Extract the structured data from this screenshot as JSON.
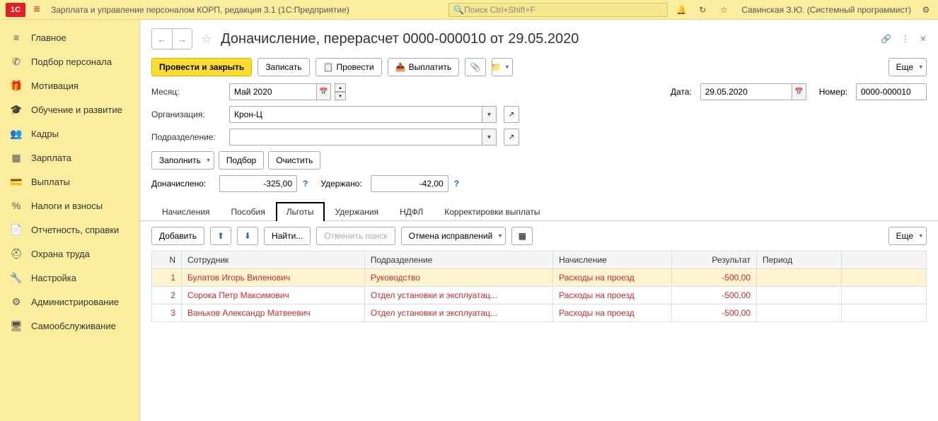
{
  "topbar": {
    "app_title": "Зарплата и управление персоналом КОРП, редакция 3.1  (1С:Предприятие)",
    "search_placeholder": "Поиск Ctrl+Shift+F",
    "user": "Савинская З.Ю. (Системный программист)"
  },
  "sidebar": {
    "items": [
      "Главное",
      "Подбор персонала",
      "Мотивация",
      "Обучение и развитие",
      "Кадры",
      "Зарплата",
      "Выплаты",
      "Налоги и взносы",
      "Отчетность, справки",
      "Охрана труда",
      "Настройка",
      "Администрирование",
      "Самообслуживание"
    ]
  },
  "doc": {
    "title": "Доначисление, перерасчет 0000-000010 от 29.05.2020"
  },
  "toolbar": {
    "post_close": "Провести и закрыть",
    "write": "Записать",
    "post": "Провести",
    "pay": "Выплатить",
    "more": "Еще"
  },
  "form": {
    "month_label": "Месяц:",
    "month_value": "Май 2020",
    "date_label": "Дата:",
    "date_value": "29.05.2020",
    "number_label": "Номер:",
    "number_value": "0000-000010",
    "org_label": "Организация:",
    "org_value": "Крон-Ц",
    "dept_label": "Подразделение:",
    "dept_value": "",
    "fill": "Заполнить",
    "select": "Подбор",
    "clear": "Очистить",
    "accrued_label": "Доначислено:",
    "accrued_value": "-325,00",
    "withheld_label": "Удержано:",
    "withheld_value": "-42,00"
  },
  "tabs": {
    "t0": "Начисления",
    "t1": "Пособия",
    "t2": "Льготы",
    "t3": "Удержания",
    "t4": "НДФЛ",
    "t5": "Корректировки выплаты"
  },
  "table_toolbar": {
    "add": "Добавить",
    "find": "Найти...",
    "cancel_search": "Отменить поиск",
    "cancel_corr": "Отмена исправлений",
    "more": "Еще"
  },
  "table": {
    "headers": {
      "n": "N",
      "employee": "Сотрудник",
      "dept": "Подразделение",
      "accrual": "Начисление",
      "result": "Результат",
      "period": "Период"
    },
    "rows": [
      {
        "n": "1",
        "employee": "Булатов Игорь Виленович",
        "dept": "Руководство",
        "accrual": "Расходы на проезд",
        "result": "-500,00",
        "period": ""
      },
      {
        "n": "2",
        "employee": "Сорока Петр Максимович",
        "dept": "Отдел установки и эксплуатац...",
        "accrual": "Расходы на проезд",
        "result": "-500,00",
        "period": ""
      },
      {
        "n": "3",
        "employee": "Ваньков Александр Матвеевич",
        "dept": "Отдел установки и эксплуатац...",
        "accrual": "Расходы на проезд",
        "result": "-500,00",
        "period": ""
      }
    ]
  }
}
